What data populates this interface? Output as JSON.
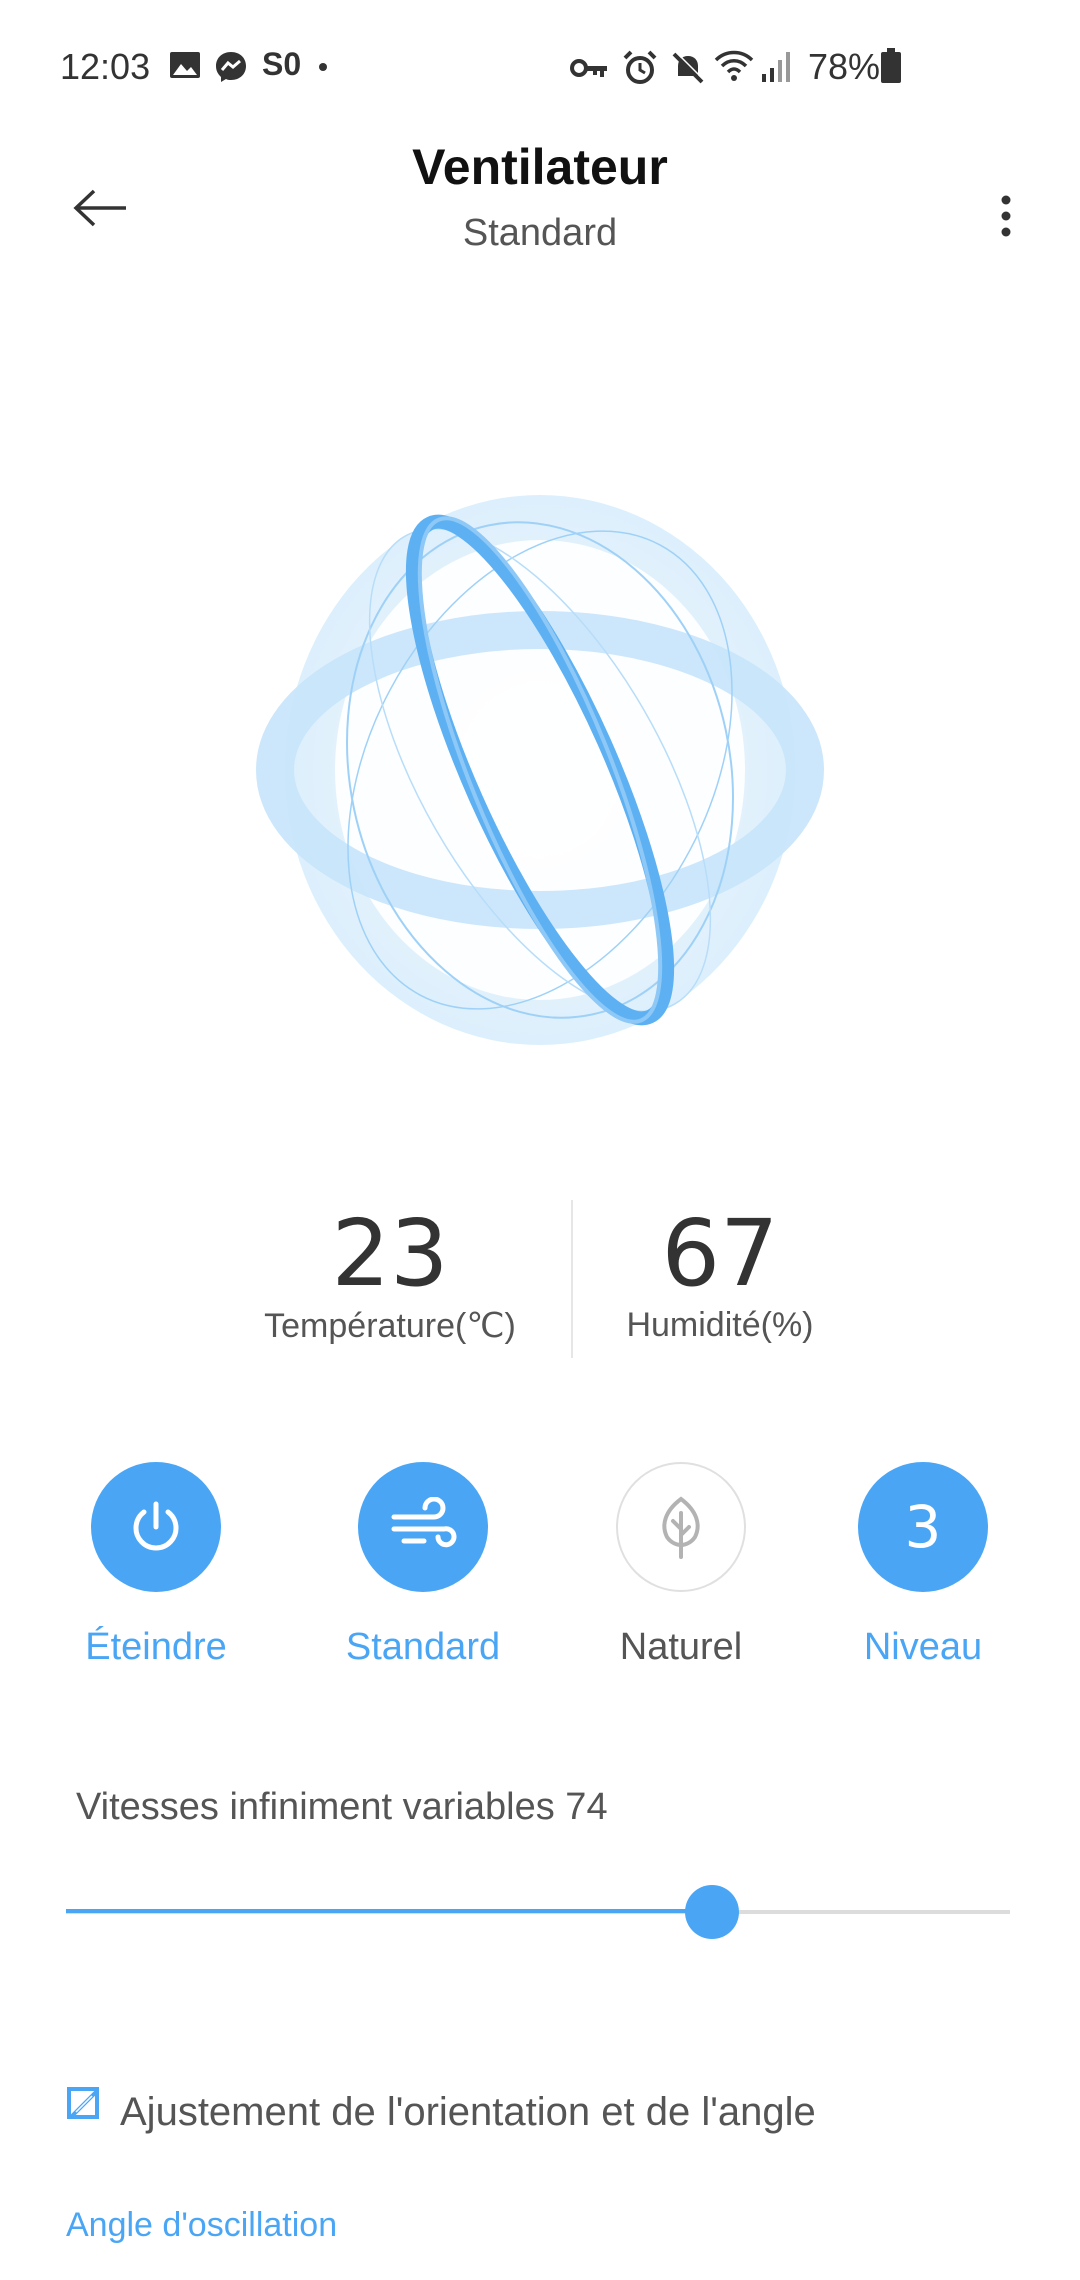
{
  "status_bar": {
    "time": "12:03",
    "battery": "78%",
    "icons": [
      "gallery-icon",
      "messenger-icon",
      "so-icon",
      "dot-icon",
      "vpn-key-icon",
      "alarm-icon",
      "mute-icon",
      "wifi-icon",
      "signal-icon",
      "battery-icon"
    ],
    "so_text": "S0"
  },
  "header": {
    "title": "Ventilateur",
    "subtitle": "Standard"
  },
  "readings": {
    "temperature_value": "23",
    "temperature_label": "Température(℃)",
    "humidity_value": "67",
    "humidity_label": "Humidité(%)"
  },
  "modes": [
    {
      "label": "Éteindre",
      "icon": "power-icon",
      "active": true
    },
    {
      "label": "Standard",
      "icon": "wind-icon",
      "active": true
    },
    {
      "label": "Naturel",
      "icon": "leaf-icon",
      "active": false
    },
    {
      "label": "Niveau",
      "icon": "level-icon",
      "active": true,
      "value": "3"
    }
  ],
  "speed": {
    "label": "Vitesses infiniment variables 74",
    "value": 74,
    "min": 0,
    "max": 100
  },
  "orientation": {
    "label": "Ajustement de l'orientation et de l'angle",
    "icon": "edit-square-icon"
  },
  "oscillation": {
    "label": "Angle d'oscillation"
  },
  "colors": {
    "accent": "#4aa6f5",
    "text": "#333333",
    "muted": "#555555"
  }
}
